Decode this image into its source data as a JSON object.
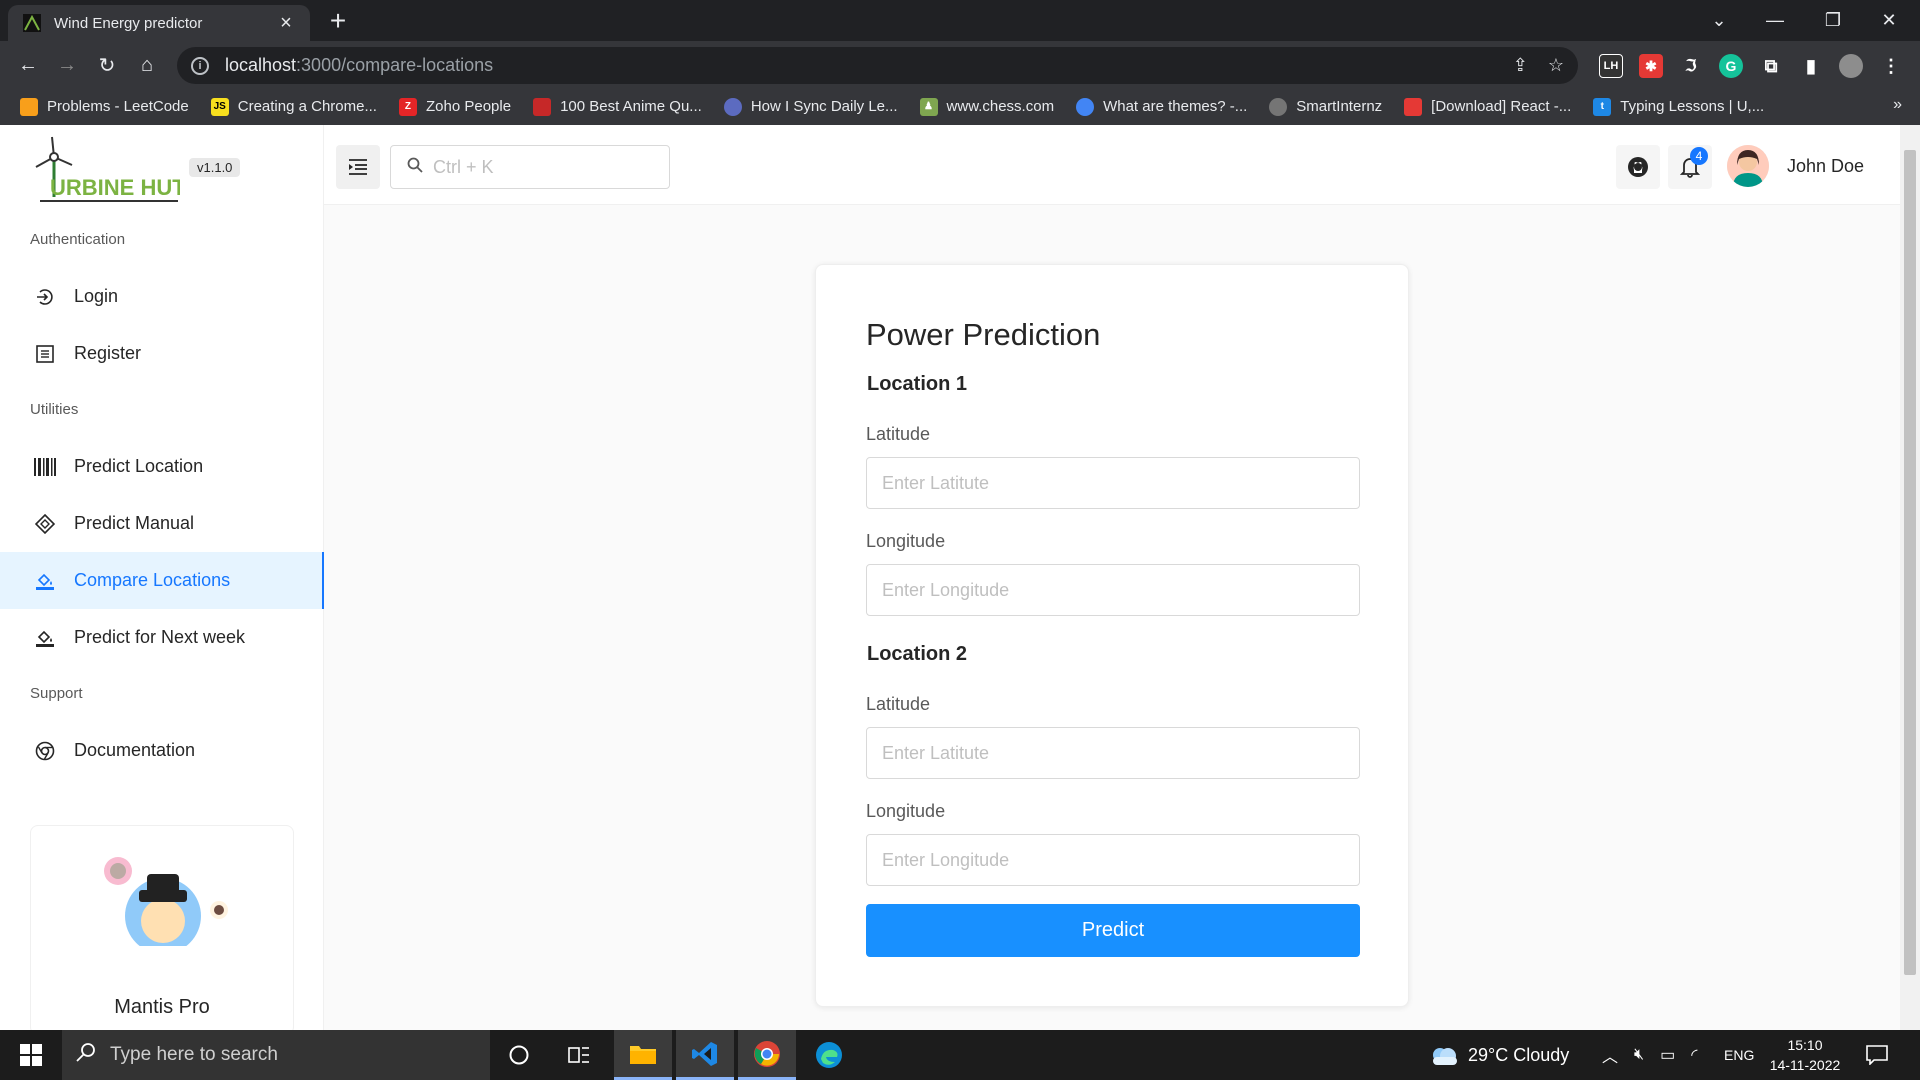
{
  "browser": {
    "tab_title": "Wind Energy predictor",
    "url_host": "localhost",
    "url_path": ":3000/compare-locations",
    "bookmarks": [
      {
        "label": "Problems - LeetCode",
        "color": "#f89f1b"
      },
      {
        "label": "Creating a Chrome...",
        "color": "#f7df1e",
        "glyph": "JS"
      },
      {
        "label": "Zoho People",
        "color": "#e42527",
        "glyph": "Z"
      },
      {
        "label": "100 Best Anime Qu...",
        "color": "#c62828"
      },
      {
        "label": "How I Sync Daily Le...",
        "color": "#5c6bc0"
      },
      {
        "label": "www.chess.com",
        "color": "#7fa650"
      },
      {
        "label": "What are themes? -...",
        "color": "#4285f4"
      },
      {
        "label": "SmartInternz",
        "color": "#757575"
      },
      {
        "label": "[Download] React -...",
        "color": "#e53935"
      },
      {
        "label": "Typing Lessons | U,...",
        "color": "#1e88e5",
        "glyph": "t"
      }
    ]
  },
  "sidebar": {
    "version": "v1.1.0",
    "sections": [
      {
        "title": "Authentication"
      },
      {
        "title": "Utilities"
      },
      {
        "title": "Support"
      }
    ],
    "items": [
      {
        "label": "Login",
        "icon": "login-icon"
      },
      {
        "label": "Register",
        "icon": "register-icon"
      },
      {
        "label": "Predict Location",
        "icon": "barcode-icon"
      },
      {
        "label": "Predict Manual",
        "icon": "diamond-icon"
      },
      {
        "label": "Compare Locations",
        "icon": "bg-colors-icon",
        "active": true
      },
      {
        "label": "Predict for Next week",
        "icon": "bg-colors-icon"
      },
      {
        "label": "Documentation",
        "icon": "chrome-icon"
      }
    ],
    "promo_name": "Mantis Pro"
  },
  "header": {
    "search_placeholder": "Ctrl + K",
    "notification_count": "4",
    "user_name": "John Doe"
  },
  "form": {
    "title": "Power Prediction",
    "location1_title": "Location 1",
    "location2_title": "Location 2",
    "latitude_label": "Latitude",
    "longitude_label": "Longitude",
    "latitude_placeholder": "Enter Latitute",
    "longitude_placeholder": "Enter Longitude",
    "submit_label": "Predict"
  },
  "taskbar": {
    "search_placeholder": "Type here to search",
    "weather": "29°C  Cloudy",
    "lang": "ENG",
    "time": "15:10",
    "date": "14-11-2022"
  },
  "colors": {
    "accent": "#1677ff",
    "button": "#1890ff",
    "active_bg": "#e6f4ff"
  }
}
